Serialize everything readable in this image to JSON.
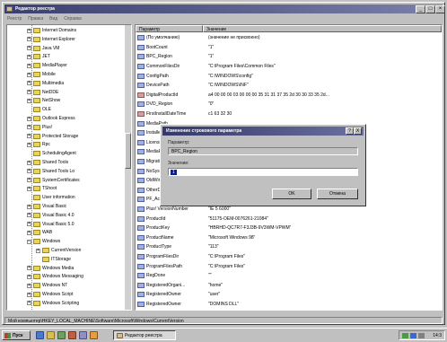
{
  "window": {
    "title": "Редактор реестра",
    "menu": [
      "Реестр",
      "Правка",
      "Вид",
      "Справка"
    ],
    "status": "Мой компьютер\\HKEY_LOCAL_MACHINE\\Software\\Microsoft\\Windows\\CurrentVersion"
  },
  "tree": {
    "items": [
      {
        "label": "Internet Domains",
        "exp": "+",
        "level": 0
      },
      {
        "label": "Internet Explorer",
        "exp": "+",
        "level": 0
      },
      {
        "label": "Java VM",
        "exp": "+",
        "level": 0
      },
      {
        "label": "JET",
        "exp": "+",
        "level": 0
      },
      {
        "label": "MediaPlayer",
        "exp": "+",
        "level": 0
      },
      {
        "label": "Mobile",
        "exp": "+",
        "level": 0
      },
      {
        "label": "Multimedia",
        "exp": "+",
        "level": 0
      },
      {
        "label": "NetDDE",
        "exp": "+",
        "level": 0
      },
      {
        "label": "NetShow",
        "exp": "+",
        "level": 0
      },
      {
        "label": "OLE",
        "exp": "",
        "level": 0
      },
      {
        "label": "Outlook Express",
        "exp": "+",
        "level": 0
      },
      {
        "label": "Plus!",
        "exp": "+",
        "level": 0
      },
      {
        "label": "Protected Storage",
        "exp": "+",
        "level": 0
      },
      {
        "label": "Rpc",
        "exp": "+",
        "level": 0
      },
      {
        "label": "SchedulingAgent",
        "exp": "",
        "level": 0
      },
      {
        "label": "Shared Tools",
        "exp": "+",
        "level": 0
      },
      {
        "label": "Shared Tools Lo",
        "exp": "+",
        "level": 0
      },
      {
        "label": "SystemCertificates",
        "exp": "+",
        "level": 0
      },
      {
        "label": "TShoot",
        "exp": "+",
        "level": 0
      },
      {
        "label": "User information",
        "exp": "",
        "level": 0
      },
      {
        "label": "Visual Basic",
        "exp": "+",
        "level": 0
      },
      {
        "label": "Visual Basic 4.0",
        "exp": "+",
        "level": 0
      },
      {
        "label": "Visual Basic 5.0",
        "exp": "+",
        "level": 0
      },
      {
        "label": "WAB",
        "exp": "+",
        "level": 0
      },
      {
        "label": "Windows",
        "exp": "−",
        "level": 0
      },
      {
        "label": "CurrentVersion",
        "exp": "+",
        "level": 1
      },
      {
        "label": "ITStorage",
        "exp": "",
        "level": 1
      },
      {
        "label": "Windows Media",
        "exp": "+",
        "level": 0
      },
      {
        "label": "Windows Messaging",
        "exp": "+",
        "level": 0
      },
      {
        "label": "Windows NT",
        "exp": "+",
        "level": 0
      },
      {
        "label": "Windows Script",
        "exp": "+",
        "level": 0
      },
      {
        "label": "Windows Scripting",
        "exp": "+",
        "level": 0
      }
    ]
  },
  "list": {
    "columns": [
      "Параметр",
      "Значение"
    ],
    "rows": [
      {
        "name": "(По умолчанию)",
        "value": "(значение не присвоено)",
        "bin": false
      },
      {
        "name": "BootCount",
        "value": "\"1\"",
        "bin": false
      },
      {
        "name": "BPC_Region",
        "value": "\"1\"",
        "bin": false
      },
      {
        "name": "CommonFilesDir",
        "value": "\"C:\\Program Files\\Common Files\"",
        "bin": false
      },
      {
        "name": "ConfigPath",
        "value": "\"C:\\WINDOWS\\config\"",
        "bin": false
      },
      {
        "name": "DevicePath",
        "value": "\"C:\\WINDOWS\\INF\"",
        "bin": false
      },
      {
        "name": "DigitalProductId",
        "value": "a4 00 00 00 03 00 00 00 35 31 31 37 35 2d 30 30 33 35 2d...",
        "bin": true
      },
      {
        "name": "DVD_Region",
        "value": "\"0\"",
        "bin": false
      },
      {
        "name": "FirstInstallDateTime",
        "value": "c1 63 32 30",
        "bin": true
      },
      {
        "name": "MediaPath",
        "value": "",
        "bin": false
      },
      {
        "name": "Installed",
        "value": "",
        "bin": false
      },
      {
        "name": "LicensingInfo",
        "value": "",
        "bin": false
      },
      {
        "name": "MediaPath",
        "value": "",
        "bin": false
      },
      {
        "name": "MigrationDefault",
        "value": "",
        "bin": false
      },
      {
        "name": "NoSysIcon",
        "value": "",
        "bin": false
      },
      {
        "name": "OldWinVer",
        "value": "",
        "bin": false
      },
      {
        "name": "OtherDevicePath",
        "value": "",
        "bin": false
      },
      {
        "name": "PF_AccessDir",
        "value": "",
        "bin": false
      },
      {
        "name": "Plus! VersionNumber",
        "value": "\"IE 5 6000\"",
        "bin": false
      },
      {
        "name": "ProductId",
        "value": "\"51175-OEM-0076261-21084\"",
        "bin": false
      },
      {
        "name": "ProductKey",
        "value": "\"HBRHD-QC7R7-F3J3B-9V3WM-VPWM\"",
        "bin": false
      },
      {
        "name": "ProductName",
        "value": "\"Microsoft Windows 98\"",
        "bin": false
      },
      {
        "name": "ProductType",
        "value": "\"113\"",
        "bin": false
      },
      {
        "name": "ProgramFilesDir",
        "value": "\"C:\\Program Files\"",
        "bin": false
      },
      {
        "name": "ProgramFilesPath",
        "value": "\"C:\\Program Files\"",
        "bin": false
      },
      {
        "name": "RegDone",
        "value": "\"\"",
        "bin": false
      },
      {
        "name": "RegisteredOrgani...",
        "value": "\"home\"",
        "bin": false
      },
      {
        "name": "RegisteredOwner",
        "value": "\"user\"",
        "bin": false
      },
      {
        "name": "RegisteredOwner",
        "value": "\"DOMINS DLL\"",
        "bin": false
      }
    ]
  },
  "dialog": {
    "title": "Изменение строкового параметра",
    "close": "?",
    "close2": "X",
    "name_label": "Параметр:",
    "name_value": "BPC_Region",
    "value_label": "Значение:",
    "value_value": "1",
    "ok": "OK",
    "cancel": "Отмена"
  },
  "taskbar": {
    "start": "Пуск",
    "task": "Редактор реестра",
    "clock": "14:3"
  },
  "colors": {
    "title": "#3a3f6e",
    "select": "#0a1e8c"
  }
}
